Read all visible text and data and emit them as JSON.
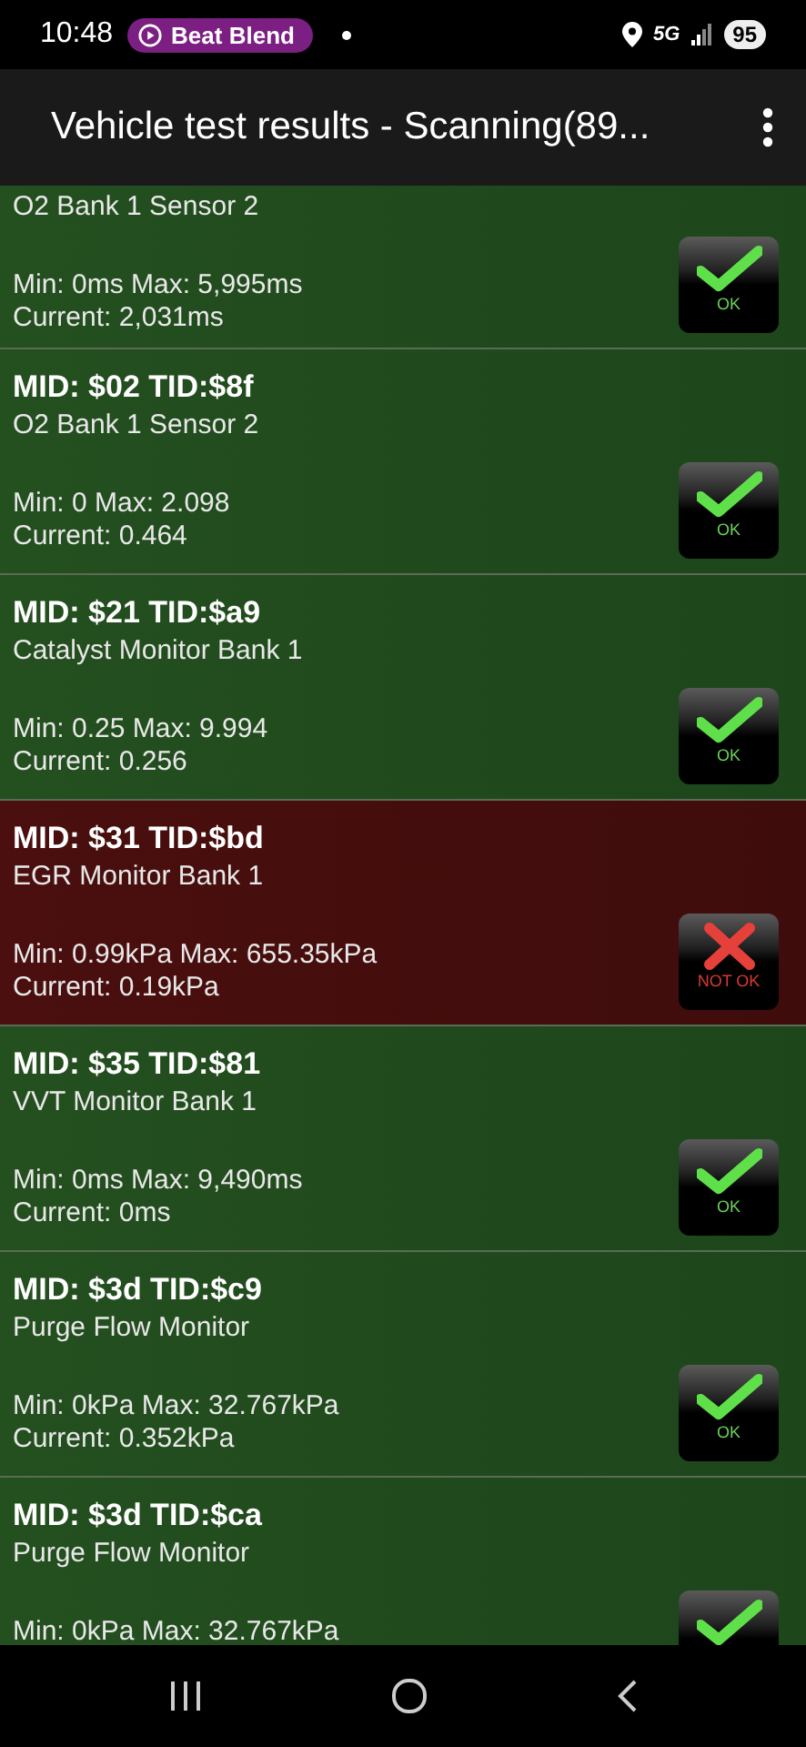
{
  "status_bar": {
    "time": "10:48",
    "media_chip": "Beat Blend",
    "network": "5G",
    "battery": "95"
  },
  "app_bar": {
    "title": "Vehicle test results - Scanning(89..."
  },
  "results": [
    {
      "name": "O2 Bank 1 Sensor 2",
      "range": "Min: 0ms  Max: 5,995ms",
      "current": "Current: 2,031ms",
      "passed": true,
      "badge": "OK"
    },
    {
      "mid": "MID: $02 TID:$8f",
      "name": "O2 Bank 1 Sensor 2",
      "range": "Min: 0  Max: 2.098",
      "current": "Current: 0.464",
      "passed": true,
      "badge": "OK"
    },
    {
      "mid": "MID: $21 TID:$a9",
      "name": "Catalyst Monitor Bank 1",
      "range": "Min: 0.25  Max: 9.994",
      "current": "Current: 0.256",
      "passed": true,
      "badge": "OK"
    },
    {
      "mid": "MID: $31 TID:$bd",
      "name": "EGR Monitor Bank 1",
      "range": "Min: 0.99kPa  Max: 655.35kPa",
      "current": "Current: 0.19kPa",
      "passed": false,
      "badge": "NOT OK"
    },
    {
      "mid": "MID: $35 TID:$81",
      "name": "VVT Monitor Bank 1",
      "range": "Min: 0ms  Max: 9,490ms",
      "current": "Current: 0ms",
      "passed": true,
      "badge": "OK"
    },
    {
      "mid": "MID: $3d TID:$c9",
      "name": "Purge Flow Monitor",
      "range": "Min: 0kPa  Max: 32.767kPa",
      "current": "Current: 0.352kPa",
      "passed": true,
      "badge": "OK"
    },
    {
      "mid": "MID: $3d TID:$ca",
      "name": "Purge Flow Monitor",
      "range": "Min: 0kPa  Max: 32.767kPa",
      "passed": true
    }
  ]
}
